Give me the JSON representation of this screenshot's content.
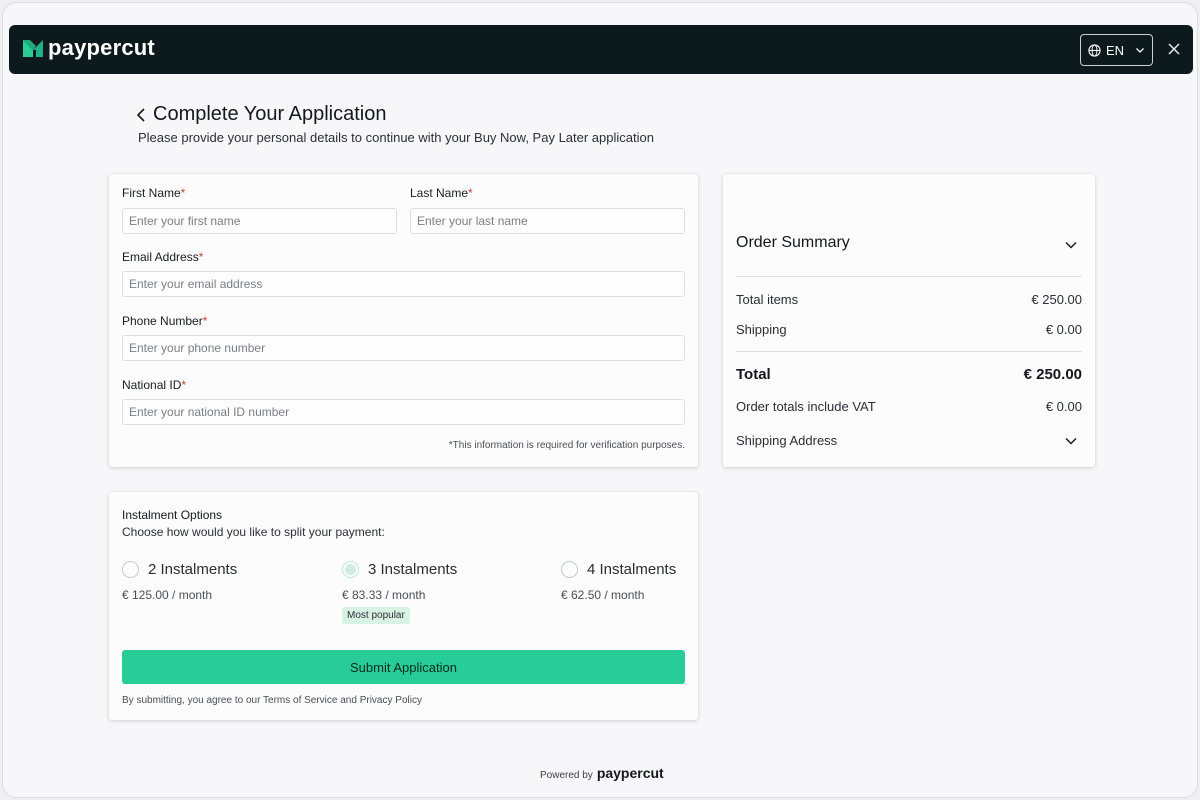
{
  "header": {
    "brand": "paypercut",
    "language": "EN",
    "brand_color": "#27cc96",
    "bar_color": "#0d1a1d"
  },
  "page": {
    "title": "Complete Your Application",
    "subtitle": "Please provide your personal details to continue with your Buy Now, Pay Later application"
  },
  "form": {
    "first_name": {
      "label": "First Name",
      "required": "*",
      "placeholder": "Enter your first name",
      "value": ""
    },
    "last_name": {
      "label": "Last Name",
      "required": "*",
      "placeholder": "Enter your last name",
      "value": ""
    },
    "email": {
      "label": "Email Address",
      "required": "*",
      "placeholder": "Enter your email address",
      "value": ""
    },
    "phone": {
      "label": "Phone Number",
      "required": "*",
      "placeholder": "Enter your phone number",
      "value": ""
    },
    "national_id": {
      "label": "National ID",
      "required": "*",
      "placeholder": "Enter your national ID number",
      "value": ""
    },
    "note": "*This information is required for verification purposes."
  },
  "summary": {
    "title": "Order Summary",
    "total_items_label": "Total items",
    "total_items_value": "€ 250.00",
    "shipping_label": "Shipping",
    "shipping_value": "€ 0.00",
    "total_label": "Total",
    "total_value": "€ 250.00",
    "vat_label": "Order totals include VAT",
    "vat_value": "€ 0.00",
    "shipping_address_label": "Shipping Address"
  },
  "instalments": {
    "title": "Instalment Options",
    "subtitle": "Choose how would you like to split your payment:",
    "options": [
      {
        "label": "2 Instalments",
        "price": "€ 125.00 / month",
        "selected": false
      },
      {
        "label": "3 Instalments",
        "price": "€ 83.33 / month",
        "selected": true,
        "badge": "Most popular"
      },
      {
        "label": "4 Instalments",
        "price": "€ 62.50 / month",
        "selected": false
      }
    ],
    "submit_label": "Submit Application",
    "terms": "By submitting, you agree to our Terms of Service and Privacy Policy"
  },
  "footer": {
    "powered_by": "Powered by",
    "brand": "paypercut"
  }
}
